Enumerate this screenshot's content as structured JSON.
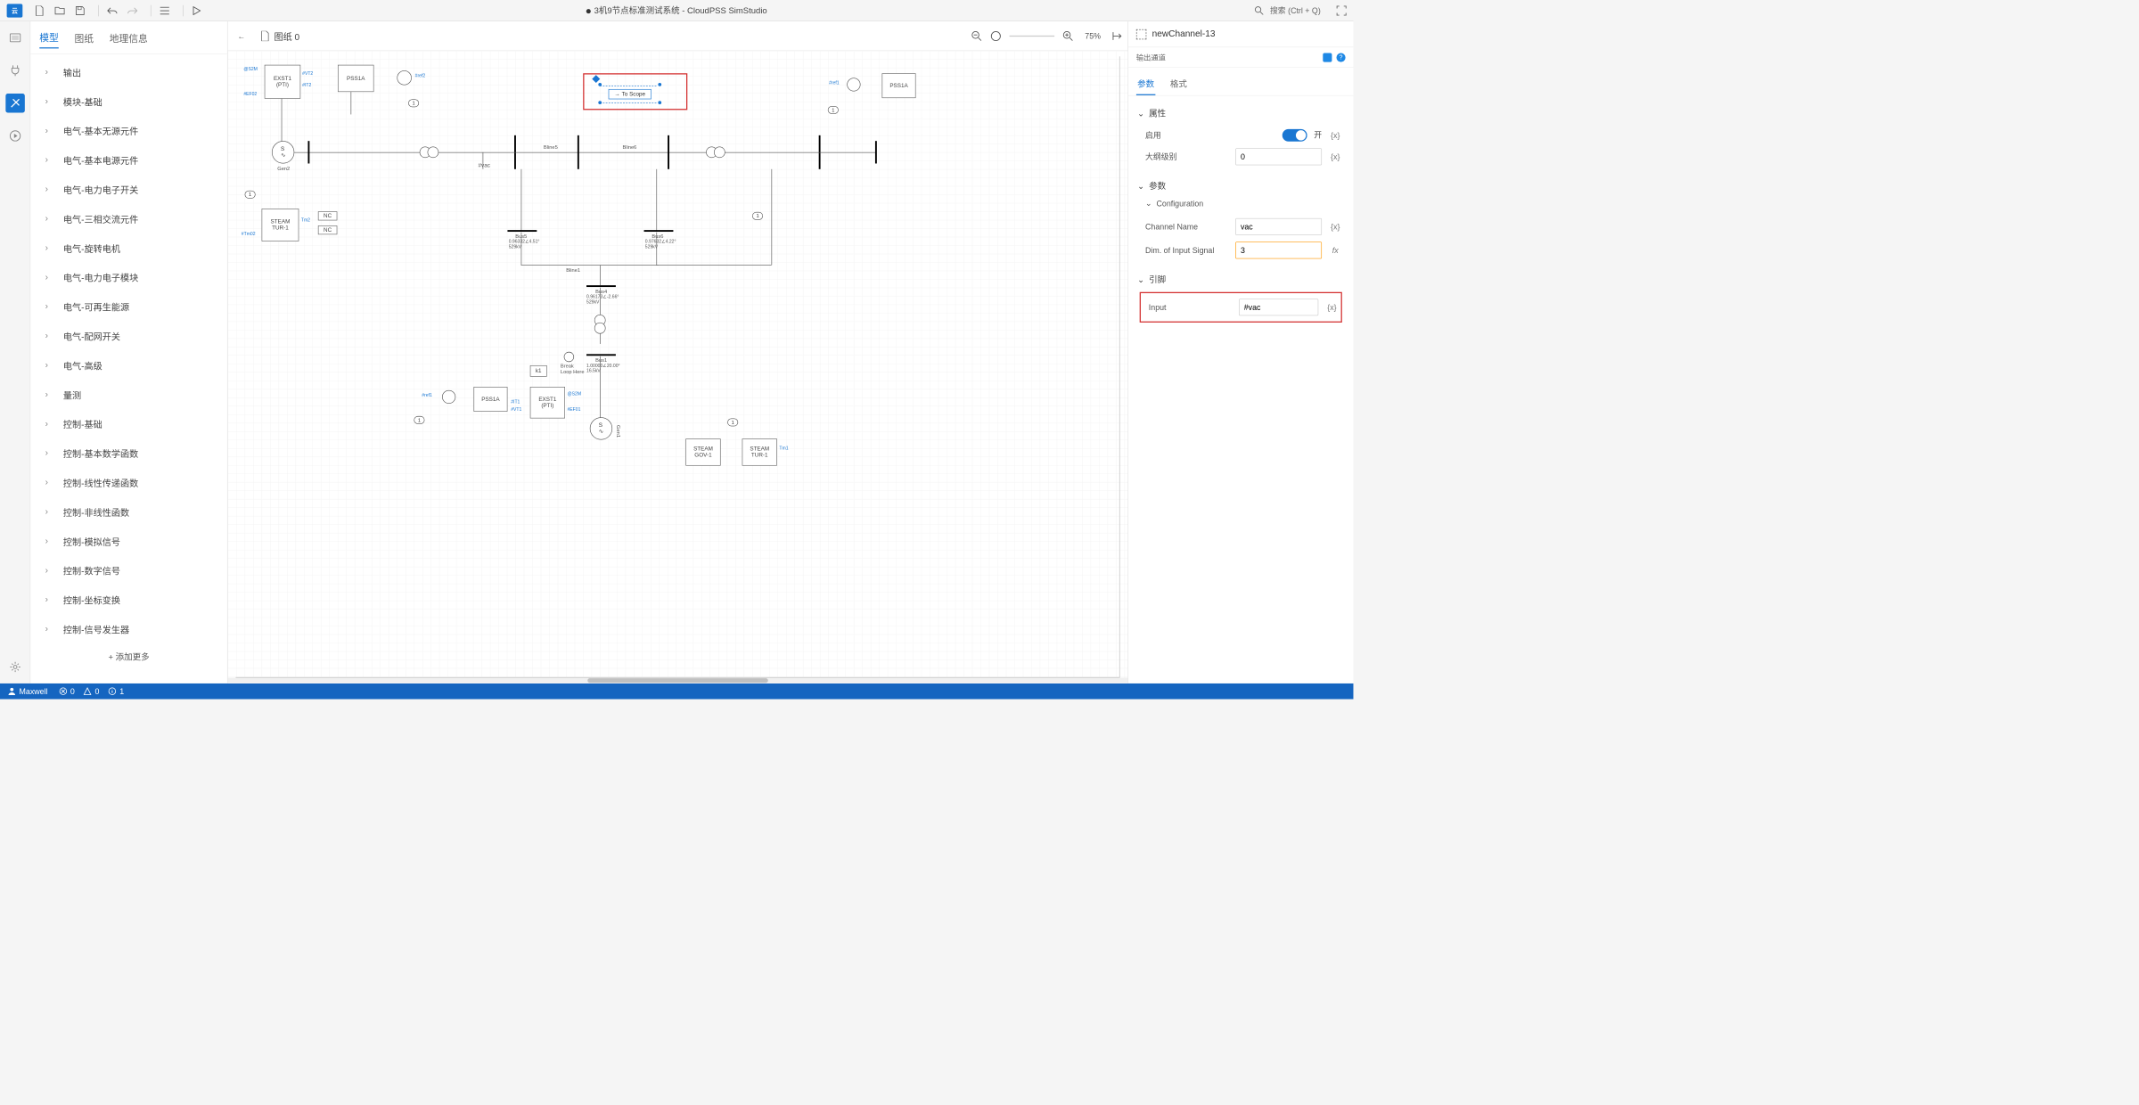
{
  "topbar": {
    "title": "3机9节点标准测试系统 - CloudPSS SimStudio",
    "search_hint": "搜索 (Ctrl + Q)"
  },
  "left_tabs": {
    "t0": "模型",
    "t1": "图纸",
    "t2": "地理信息"
  },
  "tree": {
    "items": [
      "输出",
      "模块-基础",
      "电气-基本无源元件",
      "电气-基本电源元件",
      "电气-电力电子开关",
      "电气-三相交流元件",
      "电气-旋转电机",
      "电气-电力电子模块",
      "电气-可再生能源",
      "电气-配网开关",
      "电气-高级",
      "量测",
      "控制-基础",
      "控制-基本数学函数",
      "控制-线性传递函数",
      "控制-非线性函数",
      "控制-模拟信号",
      "控制-数字信号",
      "控制-坐标变换",
      "控制-信号发生器"
    ],
    "add_more": "+  添加更多"
  },
  "doc": {
    "name": "图纸 0",
    "zoom": "75%"
  },
  "canvas": {
    "to_scope": "To Scope",
    "exst1": "EXST1\n(PTI)",
    "pss1a": "PSS1A",
    "steam_tur": "STEAM\nTUR-1",
    "steam_gov": "STEAM\nGOV-1",
    "gen2": "Gen2",
    "gen1": "Gen1",
    "nc": "NC",
    "break_loop": "Break\nLoop Here",
    "k1": "k1",
    "one": "1",
    "bus5": "Bus5",
    "bus5_v": "0.96332∠4.51°\n529kV",
    "bus6": "Bus6",
    "bus6_v": "0.97632∠4.22°\n529kV",
    "bus4": "Bus4",
    "bus4_v": "0.96173∠-2.66°\n529kV",
    "bus1": "Bus1",
    "bus1_v": "1.00000∠20.00°\n16.5kV",
    "pvac": "#vac",
    "vt1": "#VT1",
    "vt2": "#VT2",
    "it1": "#IT1",
    "it2": "#IT2",
    "s2m": "@S2M",
    "ef02": "#EF02",
    "tm02": "#Tm02",
    "line5": "Bline5",
    "line6": "Bline6",
    "line1": "Bline1",
    "tm1": "Tm1",
    "tm2": "Tm2",
    "ref1": "#ref1",
    "ref2": "#ref2",
    "ref01": "#EF01"
  },
  "right": {
    "header": "newChannel-13",
    "subheader": "输出通道",
    "tabs": {
      "t0": "参数",
      "t1": "格式"
    },
    "sect_attr": "属性",
    "enable_label": "启用",
    "enable_state": "开",
    "outline_label": "大纲级别",
    "outline_value": "0",
    "sect_param": "参数",
    "sect_config": "Configuration",
    "chname_label": "Channel Name",
    "chname_value": "vac",
    "dim_label": "Dim. of Input Signal",
    "dim_value": "3",
    "sect_pin": "引脚",
    "input_label": "Input",
    "input_value": "#vac",
    "x_token": "{x}",
    "fx_token": "fx"
  },
  "status": {
    "user": "Maxwell",
    "err": "0",
    "warn": "0",
    "info": "1"
  }
}
